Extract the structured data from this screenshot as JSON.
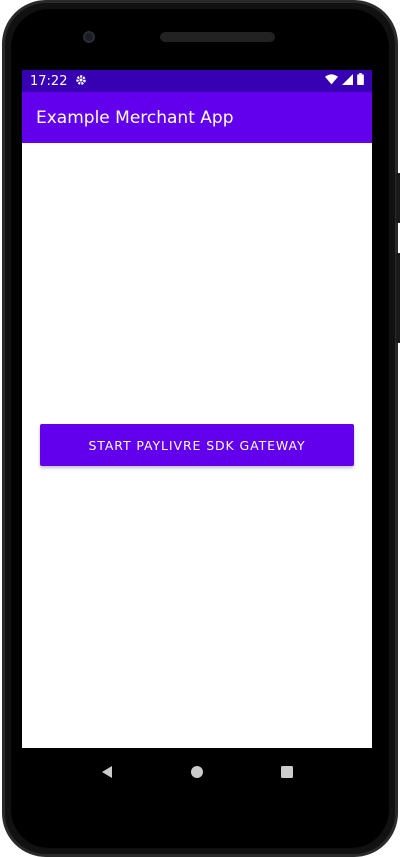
{
  "status_bar": {
    "time": "17:22",
    "icons": [
      "settings-icon",
      "wifi-icon",
      "signal-icon",
      "battery-icon"
    ]
  },
  "app_bar": {
    "title": "Example Merchant App"
  },
  "main": {
    "start_button_label": "START PAYLIVRE SDK GATEWAY"
  },
  "nav_bar": {
    "icons": [
      "back-icon",
      "home-icon",
      "recents-icon"
    ]
  },
  "colors": {
    "status_bar": "#3700b3",
    "primary": "#6200ee",
    "on_primary": "#ffffff",
    "background": "#ffffff",
    "device_frame": "#111111"
  }
}
